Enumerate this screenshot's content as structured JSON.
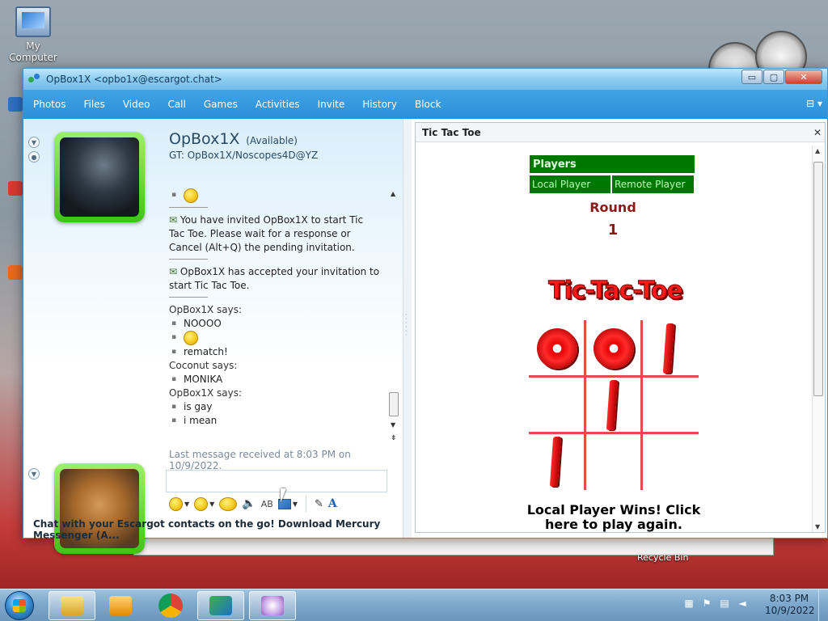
{
  "desktop": {
    "my_computer_label": "My Computer",
    "recycle_bin_label": "Recycle Bin"
  },
  "window": {
    "title": "OpBox1X <opbo1x@escargot.chat>",
    "minimize": "▭",
    "maximize": "▢",
    "close": "✕"
  },
  "menu": {
    "items": [
      "Photos",
      "Files",
      "Video",
      "Call",
      "Games",
      "Activities",
      "Invite",
      "History",
      "Block"
    ],
    "options_icon": "⊟ ▾"
  },
  "contact": {
    "name": "OpBox1X",
    "status": "(Available)",
    "gamertag": "GT: OpBox1X/Noscopes4D@YZ"
  },
  "messages": {
    "invite": "You have invited OpBox1X to start Tic Tac Toe. Please wait for a response or Cancel (Alt+Q) the pending invitation.",
    "accepted": "OpBox1X has accepted your invitation to start Tic Tac Toe.",
    "sender_1": "OpBox1X says:",
    "msg_1": "NOOOO",
    "msg_2": "rematch!",
    "sender_2": "Coconut says:",
    "msg_3": "MONIKA",
    "sender_3": "OpBox1X says:",
    "msg_4": "is gay",
    "msg_5": "i mean"
  },
  "last_received": "Last message received at 8:03 PM on 10/9/2022.",
  "toolbar": {
    "voice_icon": "((●))",
    "font_label": "AB"
  },
  "ad_text": "Chat with your Escargot contacts on the go! Download Mercury Messenger (A...",
  "activity": {
    "title": "Tic Tac Toe",
    "close": "✕",
    "players_header": "Players",
    "local_player": "Local Player",
    "remote_player": "Remote Player",
    "round_label": "Round",
    "round_number": "1",
    "logo_text": "Tic-Tac-Toe",
    "board": [
      "O",
      "O",
      "X",
      "",
      "X",
      "",
      "X",
      "",
      ""
    ],
    "win_message": "Local Player Wins! Click here to play again."
  },
  "taskbar": {
    "time": "8:03 PM",
    "date": "10/9/2022"
  },
  "colors": {
    "menubar": "#2b8fd8",
    "player_green": "#007700",
    "game_red": "#e30000",
    "round_text": "#8b1a1a",
    "avatar_frame": "#40c21a"
  }
}
